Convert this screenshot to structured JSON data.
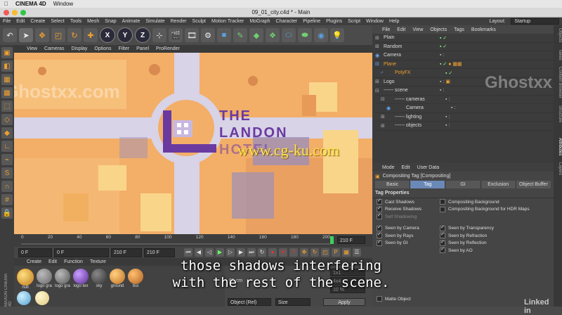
{
  "mac_menu": {
    "app": "CINEMA 4D",
    "window": "Window"
  },
  "window_title": "09_01_city.c4d * - Main",
  "main_menu": [
    "File",
    "Edit",
    "Create",
    "Select",
    "Tools",
    "Mesh",
    "Snap",
    "Animate",
    "Simulate",
    "Render",
    "Sculpt",
    "Motion Tracker",
    "MoGraph",
    "Character",
    "Pipeline",
    "Plugins",
    "Script",
    "Window",
    "Help"
  ],
  "layout": {
    "label": "Layout:",
    "value": "Startup"
  },
  "toolbar_axes": [
    "X",
    "Y",
    "Z"
  ],
  "viewport_menu": [
    "View",
    "Cameras",
    "Display",
    "Options",
    "Filter",
    "Panel",
    "ProRender"
  ],
  "logo": {
    "line1": "THE",
    "line2": "LANDON",
    "line3": "HOTEL"
  },
  "watermarks": {
    "site": "www.cg-ku.com",
    "left": "Ghostxx.com",
    "center": "Ghostxx"
  },
  "timeline": {
    "ticks": [
      "0",
      "20",
      "40",
      "60",
      "80",
      "100",
      "120",
      "140",
      "160",
      "180",
      "200"
    ],
    "end": "210 F",
    "current_frame": "0 F",
    "start_field": "0 F",
    "end_field": "210 F",
    "end_field2": "210 F"
  },
  "object_manager": {
    "menu": [
      "File",
      "Edit",
      "View",
      "Objects",
      "Tags",
      "Bookmarks"
    ],
    "rows": [
      {
        "name": "Plain",
        "indent": 0
      },
      {
        "name": "Random",
        "indent": 0
      },
      {
        "name": "Camera",
        "indent": 0
      },
      {
        "name": "Plane",
        "indent": 0
      },
      {
        "name": "PolyFX",
        "indent": 1
      },
      {
        "name": "Logo",
        "indent": 0
      },
      {
        "name": "------ scene",
        "indent": 0
      },
      {
        "name": "------ cameras",
        "indent": 1
      },
      {
        "name": "Camera",
        "indent": 2
      },
      {
        "name": "------ lighting",
        "indent": 1
      },
      {
        "name": "------ objects",
        "indent": 1
      }
    ]
  },
  "attribute_manager": {
    "menu": [
      "Mode",
      "Edit",
      "User Data"
    ],
    "title": "Compositing Tag [Compositing]",
    "tabs": [
      "Basic",
      "Tag",
      "GI",
      "Exclusion",
      "Object Buffer"
    ],
    "section": "Tag Properties",
    "left_props": [
      "Cast Shadows",
      "Receive Shadows",
      "Self Shadowing",
      "Seen by Camera",
      "Seen by Rays",
      "Seen by GI"
    ],
    "right_props": [
      "Compositing Background",
      "Compositing Background for HDR Maps",
      "",
      "Seen by Transparency",
      "Seen by Refraction",
      "Seen by Reflection",
      "Seen by AO"
    ],
    "lower_props": [
      "Matte Object"
    ]
  },
  "material_menu": [
    "Create",
    "Edit",
    "Function",
    "Texture"
  ],
  "materials": [
    "null",
    "logo gra",
    "logo gra",
    "logo tex",
    "sky",
    "ground",
    "bui",
    "",
    ""
  ],
  "coords": {
    "size_label": "65 cm",
    "object_dropdown": "Object (Rel)",
    "size_dropdown": "Size",
    "apply": "Apply",
    "val1": "1x1",
    "val2": "4x4",
    "val3": "10 %"
  },
  "side_tabs": [
    "Objects",
    "Takes",
    "Content Browser",
    "Structure",
    "Attributes",
    "Layers"
  ],
  "subtitle": {
    "line1": "those shadows interfering",
    "line2": "with the rest of the scene."
  },
  "linkedin": "Linked in",
  "maxon": "MAXON CINEMA 4D"
}
